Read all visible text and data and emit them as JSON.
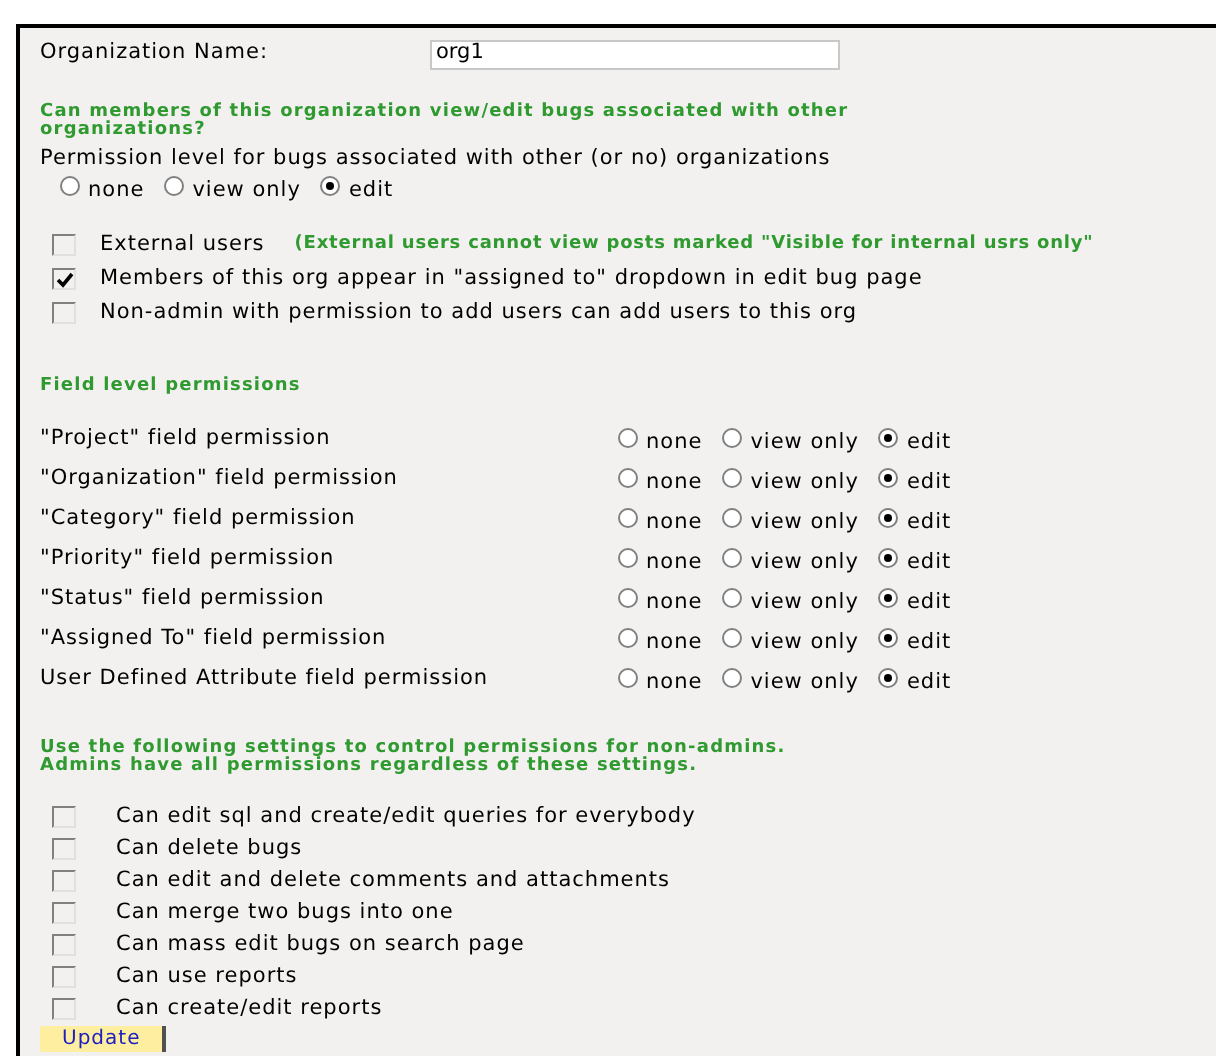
{
  "org_name": {
    "label": "Organization Name:",
    "value": "org1"
  },
  "other_orgs": {
    "heading_lines": [
      "Can members of this organization view/edit bugs associated with other",
      "organizations?"
    ],
    "label": "Permission level for bugs associated with other (or no) organizations",
    "options": [
      {
        "label": "none",
        "selected": false
      },
      {
        "label": "view only",
        "selected": false
      },
      {
        "label": "edit",
        "selected": true
      }
    ]
  },
  "org_flags": [
    {
      "label": "External users",
      "checked": false,
      "note": "(External users cannot view posts marked \"Visible for internal usrs only\""
    },
    {
      "label": "Members of this org appear in \"assigned to\" dropdown in edit bug page",
      "checked": true
    },
    {
      "label": "Non-admin with permission to add users can add users to this org",
      "checked": false
    }
  ],
  "field_permissions": {
    "heading": "Field level permissions",
    "rows": [
      {
        "label": "\"Project\" field permission",
        "options": [
          {
            "label": "none",
            "selected": false
          },
          {
            "label": "view only",
            "selected": false
          },
          {
            "label": "edit",
            "selected": true
          }
        ]
      },
      {
        "label": "\"Organization\" field permission",
        "options": [
          {
            "label": "none",
            "selected": false
          },
          {
            "label": "view only",
            "selected": false
          },
          {
            "label": "edit",
            "selected": true
          }
        ]
      },
      {
        "label": "\"Category\" field permission",
        "options": [
          {
            "label": "none",
            "selected": false
          },
          {
            "label": "view only",
            "selected": false
          },
          {
            "label": "edit",
            "selected": true
          }
        ]
      },
      {
        "label": "\"Priority\" field permission",
        "options": [
          {
            "label": "none",
            "selected": false
          },
          {
            "label": "view only",
            "selected": false
          },
          {
            "label": "edit",
            "selected": true
          }
        ]
      },
      {
        "label": "\"Status\" field permission",
        "options": [
          {
            "label": "none",
            "selected": false
          },
          {
            "label": "view only",
            "selected": false
          },
          {
            "label": "edit",
            "selected": true
          }
        ]
      },
      {
        "label": "\"Assigned To\" field permission",
        "options": [
          {
            "label": "none",
            "selected": false
          },
          {
            "label": "view only",
            "selected": false
          },
          {
            "label": "edit",
            "selected": true
          }
        ]
      },
      {
        "label": "User Defined Attribute field permission",
        "options": [
          {
            "label": "none",
            "selected": false
          },
          {
            "label": "view only",
            "selected": false
          },
          {
            "label": "edit",
            "selected": true
          }
        ]
      }
    ]
  },
  "non_admin": {
    "heading_lines": [
      "Use the following settings to control permissions for non-admins.",
      "Admins have all permissions regardless of these settings."
    ],
    "permissions": [
      {
        "label": "Can edit sql and create/edit queries for everybody",
        "checked": false
      },
      {
        "label": "Can delete bugs",
        "checked": false
      },
      {
        "label": "Can edit and delete comments and attachments",
        "checked": false
      },
      {
        "label": "Can merge two bugs into one",
        "checked": false
      },
      {
        "label": "Can mass edit bugs on search page",
        "checked": false
      },
      {
        "label": "Can use reports",
        "checked": false
      },
      {
        "label": "Can create/edit reports",
        "checked": false
      }
    ]
  },
  "update_button": "Update"
}
